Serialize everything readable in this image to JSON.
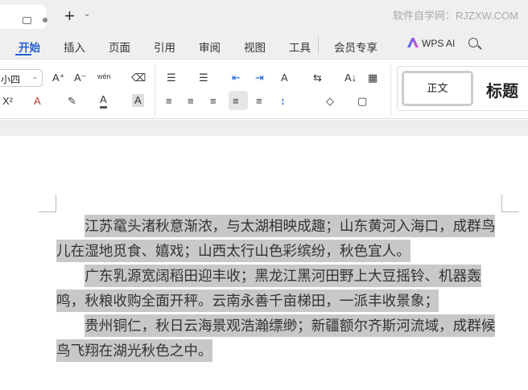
{
  "titlebar": {
    "new_tab": "+",
    "new_tab_menu": "⌄",
    "watermark": "软件自学网：RJZXW.COM"
  },
  "menu": {
    "items": [
      "开始",
      "插入",
      "页面",
      "引用",
      "审阅",
      "视图",
      "工具",
      "会员专享"
    ],
    "wps_ai": "WPS AI"
  },
  "ribbon": {
    "font_size": "小四",
    "font_size_arrow": "⌄",
    "grow": "A⁺",
    "shrink": "A⁻",
    "phonetic": "wén",
    "clear": "⌫",
    "superscript": "X²",
    "text_effect": "A",
    "highlight": "✎",
    "font_color": "A",
    "char_shade": "A",
    "bullets": "☰",
    "numbering": "☰",
    "outdent": "⇤",
    "indent": "⇥",
    "char_spacing": "A",
    "direction": "⇆",
    "sort": "A↓",
    "table": "▦",
    "align_left": "≡",
    "center": "≡",
    "align_right": "≡",
    "justify": "≡",
    "distributed": "≡",
    "line_spacing": "↕",
    "shading": "◇",
    "borders": "▢",
    "styles": {
      "normal": "正文",
      "heading": "标题"
    }
  },
  "document": {
    "paragraphs": [
      "江苏鼋头渚秋意渐浓，与太湖相映成趣；山东黄河入海口，成群鸟儿在湿地觅食、嬉戏；山西太行山色彩缤纷，秋色宜人。",
      "广东乳源宽阔稻田迎丰收；黑龙江黑河田野上大豆摇铃、机器轰鸣，秋粮收购全面开秤。云南永善千亩梯田，一派丰收景象；",
      "贵州铜仁，秋日云海景观浩瀚缥缈；新疆额尔齐斯河流域，成群候鸟飞翔在湖光秋色之中。"
    ]
  }
}
